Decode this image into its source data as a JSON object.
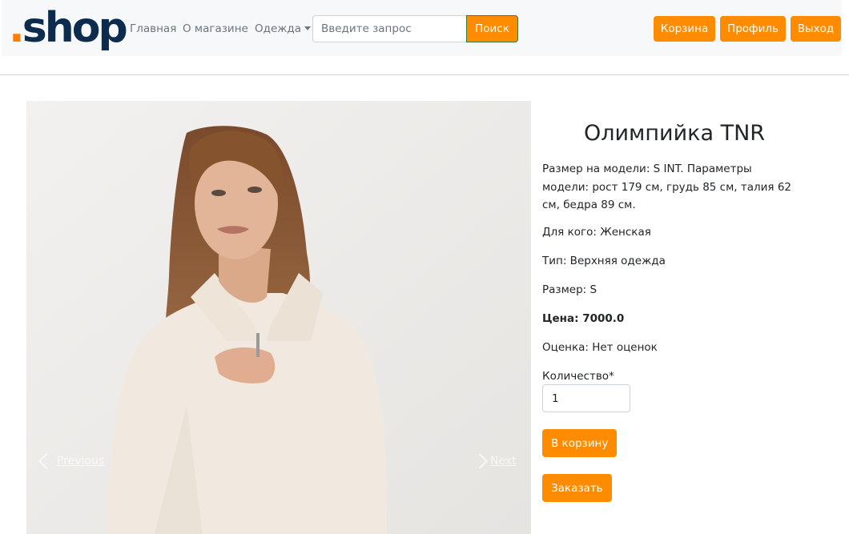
{
  "navbar": {
    "logo_dot": ".",
    "logo_text": "shop",
    "links": [
      "Главная",
      "О магазине",
      "Одежда"
    ],
    "search": {
      "placeholder": "Введите запрос",
      "value": "",
      "button_label": "Поиск"
    },
    "buttons": [
      "Корзина",
      "Профиль",
      "Выход"
    ]
  },
  "carousel": {
    "prev_label": "Previous",
    "next_label": "Next"
  },
  "product": {
    "title": "Олимпийка TNR",
    "description": "Размер на модели: S INT. Параметры модели: рост 179 см, грудь 85 см, талия 62 см, бедра 89 см.",
    "for_whom": "Для кого: Женская",
    "type": "Тип: Верхняя одежда",
    "size": "Размер: S",
    "price": "Цена: 7000.0",
    "rating": "Оценка: Нет оценок",
    "quantity_label": "Количество*",
    "quantity_value": "1",
    "add_to_cart_label": "В корзину",
    "order_label": "Заказать"
  },
  "colors": {
    "accent": "#ff8c00",
    "logo_dark": "#0d2c4d",
    "logo_dot": "#ff7f00"
  }
}
